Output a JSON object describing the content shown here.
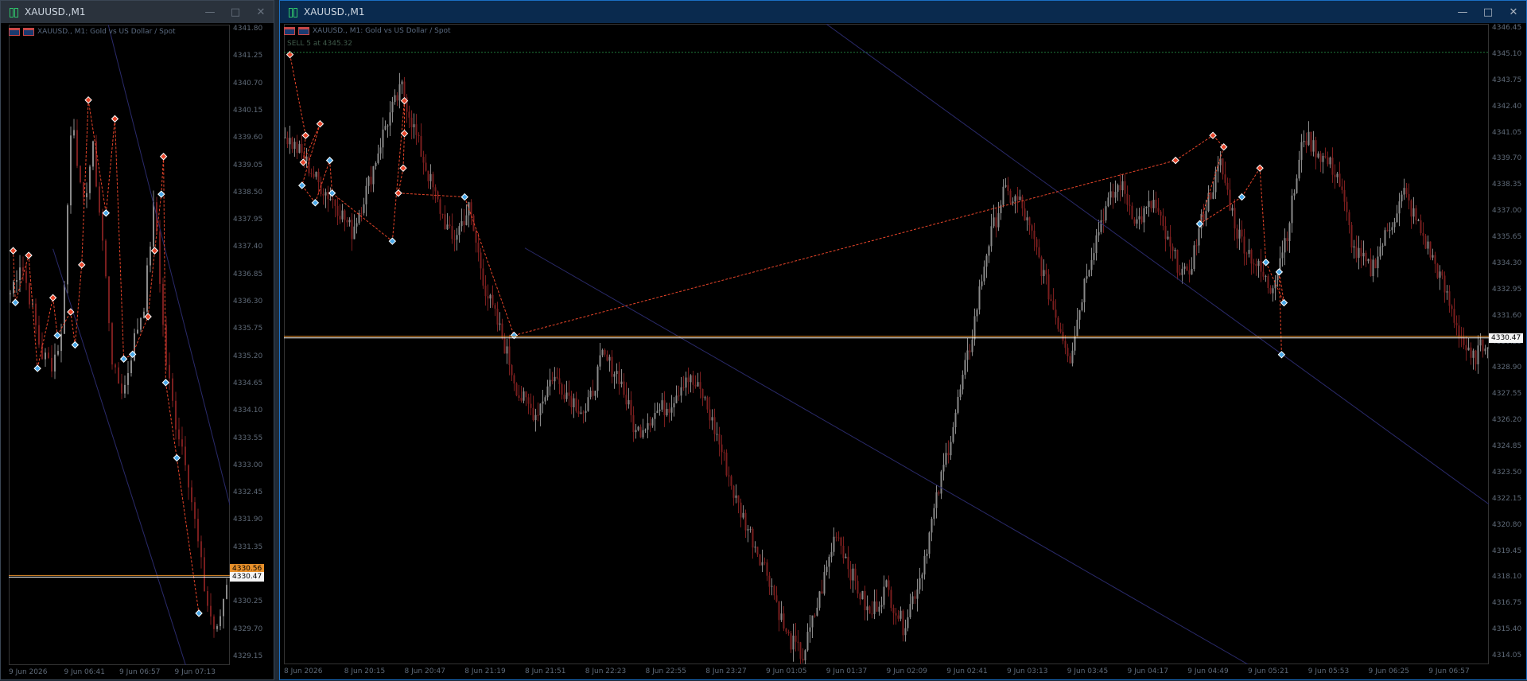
{
  "colors": {
    "bull": "#8a8a8a",
    "bear": "#7a1e1e",
    "price_line": "#f5f5f5",
    "price_line2": "#e8902a",
    "zigzag": "#e8452a",
    "diamond_up": "#e8452a",
    "diamond_dn": "#4aa8e8",
    "trend": "#2a2a6a"
  },
  "window1": {
    "title": "XAUUSD.,M1",
    "header": "XAUUSD., M1:  Gold vs US Dollar / Spot",
    "price_tag": "4330.47",
    "price_tag2": "4330.56",
    "y_ticks": [
      "4341.80",
      "4341.25",
      "4340.70",
      "4340.15",
      "4339.60",
      "4339.05",
      "4338.50",
      "4337.95",
      "4337.40",
      "4336.85",
      "4336.30",
      "4335.75",
      "4335.20",
      "4334.65",
      "4334.10",
      "4333.55",
      "4333.00",
      "4332.45",
      "4331.90",
      "4331.35",
      "4330.80",
      "4330.25",
      "4329.70",
      "4329.15"
    ],
    "x_ticks": [
      "9 Jun 2026",
      "9 Jun 06:41",
      "9 Jun 06:57",
      "9 Jun 07:13"
    ]
  },
  "window2": {
    "title": "XAUUSD.,M1",
    "header": "XAUUSD., M1:  Gold vs US Dollar / Spot",
    "sell_label": "SELL 5 at 4345.32",
    "price_tag": "4330.47",
    "y_ticks": [
      "4346.45",
      "4345.10",
      "4343.75",
      "4342.40",
      "4341.05",
      "4339.70",
      "4338.35",
      "4337.00",
      "4335.65",
      "4334.30",
      "4332.95",
      "4331.60",
      "4330.25",
      "4328.90",
      "4327.55",
      "4326.20",
      "4324.85",
      "4323.50",
      "4322.15",
      "4320.80",
      "4319.45",
      "4318.10",
      "4316.75",
      "4315.40",
      "4314.05"
    ],
    "x_ticks": [
      "8 Jun 2026",
      "8 Jun 20:15",
      "8 Jun 20:47",
      "8 Jun 21:19",
      "8 Jun 21:51",
      "8 Jun 22:23",
      "8 Jun 22:55",
      "8 Jun 23:27",
      "9 Jun 01:05",
      "9 Jun 01:37",
      "9 Jun 02:09",
      "9 Jun 02:41",
      "9 Jun 03:13",
      "9 Jun 03:45",
      "9 Jun 04:17",
      "9 Jun 04:49",
      "9 Jun 05:21",
      "9 Jun 05:53",
      "9 Jun 06:25",
      "9 Jun 06:57"
    ]
  },
  "chart_data": [
    {
      "type": "candlestick",
      "title": "XAUUSD., M1:  Gold vs US Dollar / Spot",
      "ylim": [
        4328.6,
        4342.2
      ],
      "current_price": 4330.47,
      "close_path": [
        4336.5,
        4337.2,
        4336.3,
        4335.2,
        4335.0,
        4335.6,
        4340.5,
        4338.2,
        4339.6,
        4337.5,
        4334.8,
        4334.4,
        4335.5,
        4336.3,
        4338.5,
        4335.2,
        4333.8,
        4333.0,
        4331.5,
        4330.0,
        4329.2,
        4330.4
      ],
      "zigzag_markers": [
        {
          "t": 0.02,
          "price": 4337.4,
          "kind": "high"
        },
        {
          "t": 0.03,
          "price": 4336.3,
          "kind": "low"
        },
        {
          "t": 0.09,
          "price": 4337.3,
          "kind": "high"
        },
        {
          "t": 0.13,
          "price": 4334.9,
          "kind": "low"
        },
        {
          "t": 0.2,
          "price": 4336.4,
          "kind": "high"
        },
        {
          "t": 0.22,
          "price": 4335.6,
          "kind": "low"
        },
        {
          "t": 0.28,
          "price": 4336.1,
          "kind": "high"
        },
        {
          "t": 0.3,
          "price": 4335.4,
          "kind": "low"
        },
        {
          "t": 0.33,
          "price": 4337.1,
          "kind": "high"
        },
        {
          "t": 0.36,
          "price": 4340.6,
          "kind": "high"
        },
        {
          "t": 0.44,
          "price": 4338.2,
          "kind": "low"
        },
        {
          "t": 0.48,
          "price": 4340.2,
          "kind": "high"
        },
        {
          "t": 0.52,
          "price": 4335.1,
          "kind": "low"
        },
        {
          "t": 0.56,
          "price": 4335.2,
          "kind": "low"
        },
        {
          "t": 0.63,
          "price": 4336.0,
          "kind": "high"
        },
        {
          "t": 0.66,
          "price": 4337.4,
          "kind": "high"
        },
        {
          "t": 0.69,
          "price": 4338.6,
          "kind": "low"
        },
        {
          "t": 0.7,
          "price": 4339.4,
          "kind": "high"
        },
        {
          "t": 0.71,
          "price": 4334.6,
          "kind": "low"
        },
        {
          "t": 0.76,
          "price": 4333.0,
          "kind": "low"
        },
        {
          "t": 0.86,
          "price": 4329.7,
          "kind": "low"
        }
      ]
    },
    {
      "type": "candlestick",
      "title": "XAUUSD., M1:  Gold vs US Dollar / Spot",
      "ylim": [
        4313.5,
        4346.8
      ],
      "current_price": 4330.47,
      "sell_level": 4345.32,
      "close_path": [
        4341.0,
        4340.0,
        4338.5,
        4337.5,
        4336.0,
        4338.5,
        4341.5,
        4343.5,
        4340.5,
        4337.8,
        4335.5,
        4337.2,
        4333.0,
        4330.5,
        4327.5,
        4326.5,
        4328.5,
        4327.5,
        4326.5,
        4329.5,
        4328.5,
        4325.5,
        4326.5,
        4327.0,
        4328.5,
        4327.5,
        4325.0,
        4322.0,
        4320.0,
        4318.0,
        4315.0,
        4313.9,
        4317.0,
        4320.5,
        4318.0,
        4316.0,
        4317.5,
        4315.5,
        4318.0,
        4322.0,
        4326.0,
        4330.0,
        4335.0,
        4338.0,
        4337.5,
        4335.0,
        4332.0,
        4329.5,
        4334.0,
        4337.0,
        4338.5,
        4336.5,
        4337.5,
        4335.0,
        4333.5,
        4337.0,
        4339.5,
        4336.0,
        4334.5,
        4333.0,
        4336.0,
        4341.0,
        4340.0,
        4339.0,
        4335.0,
        4334.0,
        4336.0,
        4338.0,
        4336.0,
        4334.0,
        4331.5,
        4329.2,
        4330.47
      ],
      "zigzag_markers": [
        {
          "t": 0.005,
          "price": 4345.2,
          "kind": "high"
        },
        {
          "t": 0.018,
          "price": 4341.0,
          "kind": "high"
        },
        {
          "t": 0.016,
          "price": 4339.6,
          "kind": "high"
        },
        {
          "t": 0.03,
          "price": 4341.6,
          "kind": "high"
        },
        {
          "t": 0.015,
          "price": 4338.4,
          "kind": "low"
        },
        {
          "t": 0.026,
          "price": 4337.5,
          "kind": "low"
        },
        {
          "t": 0.038,
          "price": 4339.7,
          "kind": "low"
        },
        {
          "t": 0.04,
          "price": 4338.0,
          "kind": "low"
        },
        {
          "t": 0.09,
          "price": 4335.5,
          "kind": "low"
        },
        {
          "t": 0.1,
          "price": 4342.8,
          "kind": "high"
        },
        {
          "t": 0.1,
          "price": 4341.1,
          "kind": "high"
        },
        {
          "t": 0.099,
          "price": 4339.3,
          "kind": "high"
        },
        {
          "t": 0.095,
          "price": 4338.0,
          "kind": "high"
        },
        {
          "t": 0.15,
          "price": 4337.8,
          "kind": "low"
        },
        {
          "t": 0.191,
          "price": 4330.6,
          "kind": "low"
        },
        {
          "t": 0.74,
          "price": 4339.7,
          "kind": "high"
        },
        {
          "t": 0.771,
          "price": 4341.0,
          "kind": "high"
        },
        {
          "t": 0.78,
          "price": 4340.4,
          "kind": "high"
        },
        {
          "t": 0.76,
          "price": 4336.4,
          "kind": "low"
        },
        {
          "t": 0.795,
          "price": 4337.8,
          "kind": "low"
        },
        {
          "t": 0.81,
          "price": 4339.3,
          "kind": "high"
        },
        {
          "t": 0.815,
          "price": 4334.4,
          "kind": "low"
        },
        {
          "t": 0.83,
          "price": 4332.3,
          "kind": "low"
        },
        {
          "t": 0.826,
          "price": 4333.9,
          "kind": "low"
        },
        {
          "t": 0.828,
          "price": 4329.6,
          "kind": "low"
        }
      ]
    }
  ]
}
